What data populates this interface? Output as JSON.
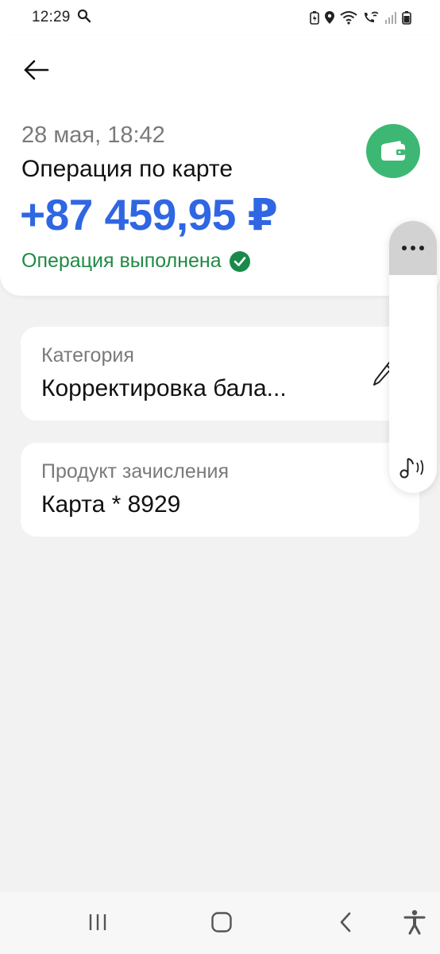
{
  "status_bar": {
    "time": "12:29",
    "icons": [
      "search-icon",
      "battery-saver-icon",
      "location-icon",
      "wifi-icon",
      "wifi-calling-icon",
      "signal-icon",
      "battery-icon"
    ]
  },
  "header": {
    "back_icon": "arrow-left-icon",
    "date": "28 мая, 18:42",
    "title": "Операция по карте",
    "amount": "+87 459,95 ₽",
    "status": "Операция выполнена",
    "status_icon": "check-circle-icon",
    "wallet_icon": "wallet-icon"
  },
  "cards": {
    "category": {
      "label": "Категория",
      "value": "Корректировка бала..."
    },
    "product": {
      "label": "Продукт зачисления",
      "value": "Карта * 8929"
    }
  },
  "side_panel": {
    "more_icon": "more-horizontal-icon",
    "music_icon": "music-note-icon"
  },
  "nav_bar": {
    "buttons": [
      "recent-apps-icon",
      "home-icon",
      "back-icon",
      "accessibility-icon"
    ]
  },
  "colors": {
    "amount": "#2f66e3",
    "status_green": "#1f8a45",
    "wallet_bg": "#3cb874",
    "background": "#f2f2f2"
  }
}
